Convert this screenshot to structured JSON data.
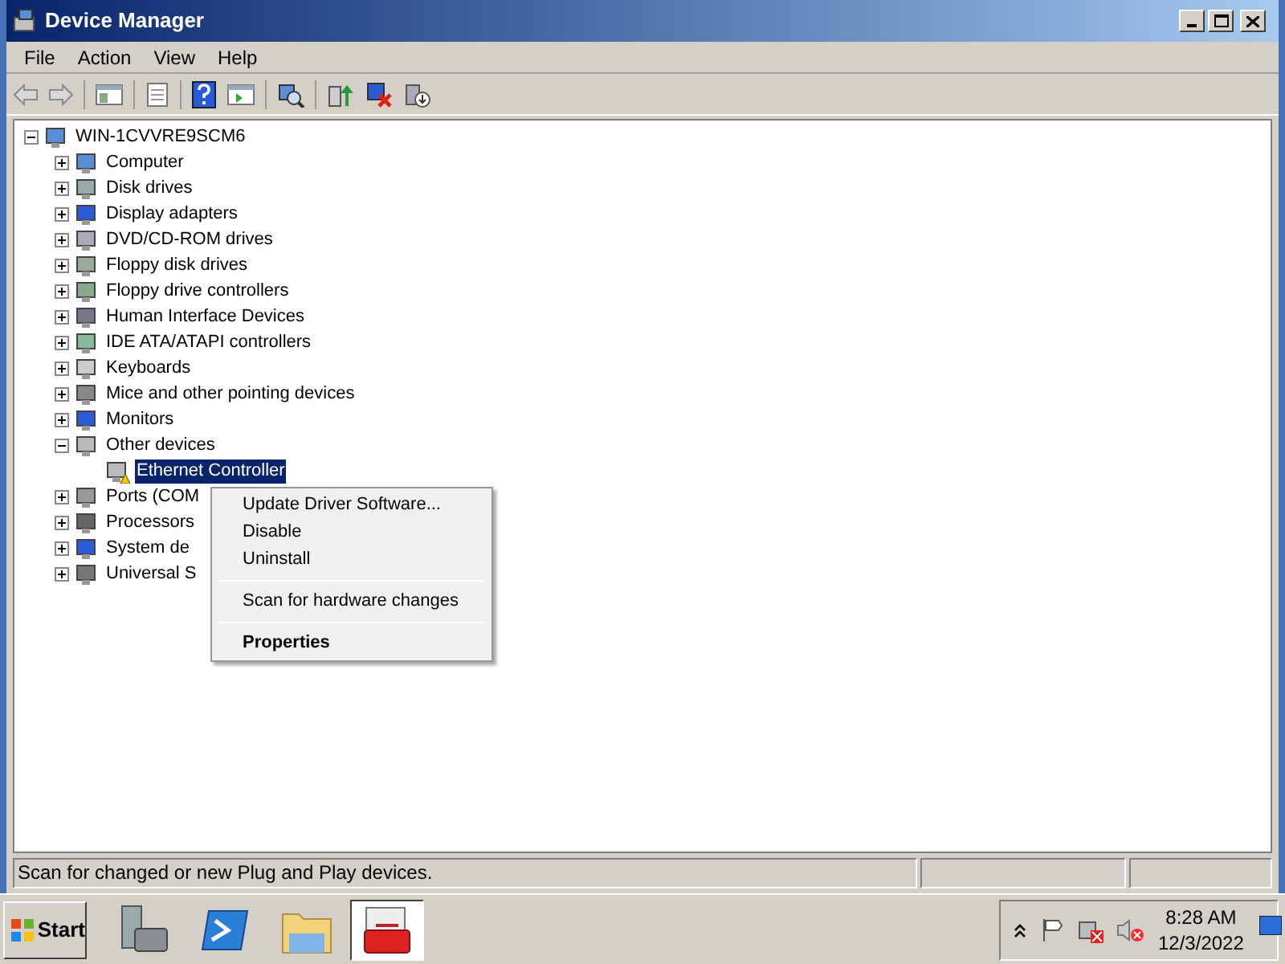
{
  "window": {
    "title": "Device Manager"
  },
  "menu_bar": [
    "File",
    "Action",
    "View",
    "Help"
  ],
  "tree": {
    "label": "WIN-1CVVRE9SCM6",
    "expanded": true,
    "selected": false,
    "children": [
      {
        "label": "Computer",
        "expanded": false,
        "selected": false
      },
      {
        "label": "Disk drives",
        "expanded": false,
        "selected": false
      },
      {
        "label": "Display adapters",
        "expanded": false,
        "selected": false
      },
      {
        "label": "DVD/CD-ROM drives",
        "expanded": false,
        "selected": false
      },
      {
        "label": "Floppy disk drives",
        "expanded": false,
        "selected": false
      },
      {
        "label": "Floppy drive controllers",
        "expanded": false,
        "selected": false
      },
      {
        "label": "Human Interface Devices",
        "expanded": false,
        "selected": false
      },
      {
        "label": "IDE ATA/ATAPI controllers",
        "expanded": false,
        "selected": false
      },
      {
        "label": "Keyboards",
        "expanded": false,
        "selected": false
      },
      {
        "label": "Mice and other pointing devices",
        "expanded": false,
        "selected": false
      },
      {
        "label": "Monitors",
        "expanded": false,
        "selected": false
      },
      {
        "label": "Other devices",
        "expanded": true,
        "selected": false,
        "children": [
          {
            "label": "Ethernet Controller",
            "selected": true,
            "warning": true
          }
        ]
      },
      {
        "label": "Ports (COM",
        "expanded": false,
        "selected": false
      },
      {
        "label": "Processors",
        "expanded": false,
        "selected": false
      },
      {
        "label": "System de",
        "expanded": false,
        "selected": false
      },
      {
        "label": "Universal S",
        "expanded": false,
        "selected": false
      }
    ]
  },
  "context_menu": [
    {
      "kind": "item",
      "label": "Update Driver Software...",
      "default": false
    },
    {
      "kind": "item",
      "label": "Disable",
      "default": false
    },
    {
      "kind": "item",
      "label": "Uninstall",
      "default": false
    },
    {
      "kind": "separator"
    },
    {
      "kind": "item",
      "label": "Scan for hardware changes",
      "default": false
    },
    {
      "kind": "separator"
    },
    {
      "kind": "item",
      "label": "Properties",
      "default": true
    }
  ],
  "status_bar": {
    "text": "Scan for changed or new Plug and Play devices."
  },
  "taskbar": {
    "start": "Start",
    "time": "8:28 AM",
    "date": "12/3/2022"
  }
}
